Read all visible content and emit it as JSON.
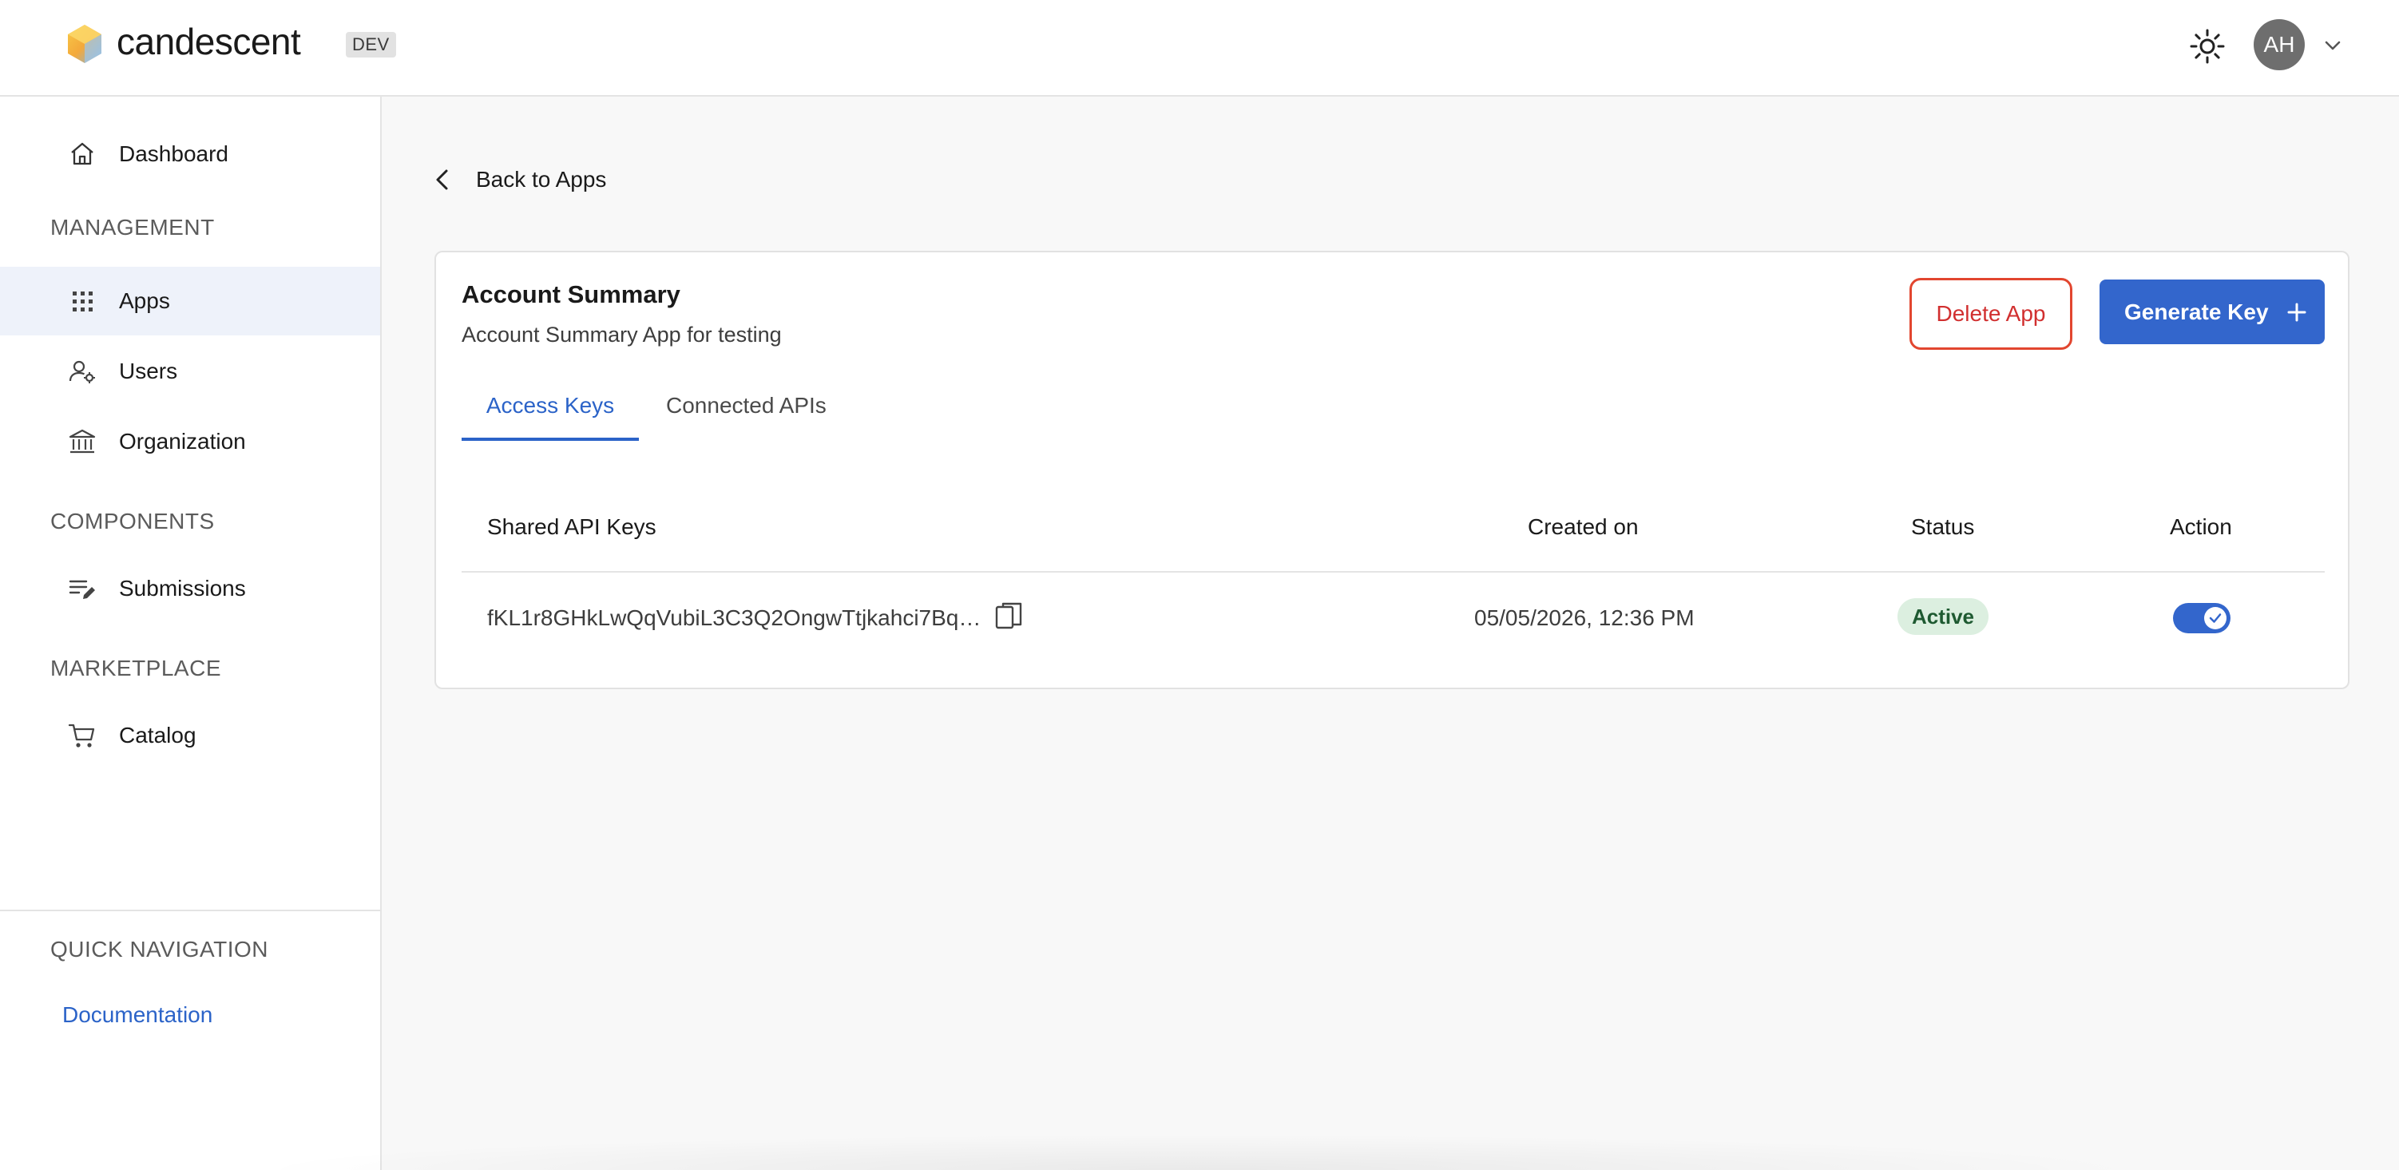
{
  "header": {
    "brand": "candescent",
    "env_badge": "DEV",
    "avatar_initials": "AH"
  },
  "sidebar": {
    "dashboard": "Dashboard",
    "sections": {
      "management": "MANAGEMENT",
      "components": "COMPONENTS",
      "marketplace": "MARKETPLACE",
      "quick_navigation": "QUICK NAVIGATION"
    },
    "items": {
      "apps": "Apps",
      "users": "Users",
      "organization": "Organization",
      "submissions": "Submissions",
      "catalog": "Catalog"
    },
    "active_item": "Apps",
    "documentation": "Documentation"
  },
  "main": {
    "back_label": "Back to Apps",
    "app": {
      "title": "Account Summary",
      "subtitle": "Account Summary App for testing"
    },
    "buttons": {
      "delete": "Delete App",
      "generate": "Generate Key"
    },
    "tabs": [
      {
        "label": "Access Keys",
        "active": true
      },
      {
        "label": "Connected APIs",
        "active": false
      }
    ],
    "table": {
      "headers": {
        "key": "Shared API Keys",
        "created": "Created on",
        "status": "Status",
        "action": "Action"
      },
      "rows": [
        {
          "key": "fKL1r8GHkLwQqVubiL3C3Q2OngwTtjkahci7Bq…",
          "created": "05/05/2026, 12:36 PM",
          "status": "Active",
          "enabled": true
        }
      ]
    }
  },
  "colors": {
    "accent": "#3366cc",
    "danger": "#e2462f",
    "active_badge_bg": "#dcefe0",
    "sidebar_active_bg": "#eef2fa"
  }
}
